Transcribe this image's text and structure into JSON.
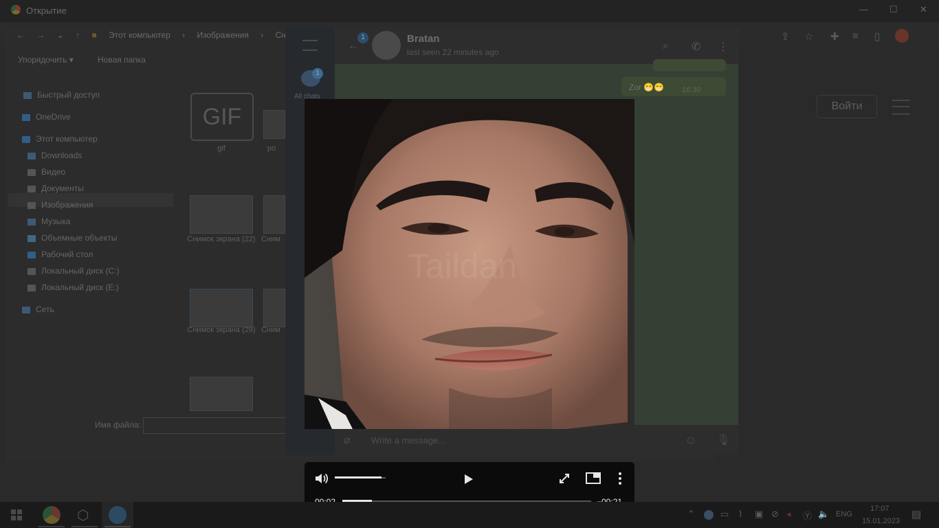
{
  "chrome": {
    "title": "Открытие",
    "login_button": "Войти"
  },
  "explorer": {
    "breadcrumb": [
      "Этот компьютер",
      "Изображения",
      "Снимки э"
    ],
    "toolbar": {
      "organize": "Упорядочить",
      "new_folder": "Новая папка"
    },
    "nav": [
      {
        "label": "Быстрый доступ",
        "icon": "star-icon",
        "color": "#3d5a75"
      },
      {
        "label": "OneDrive",
        "icon": "cloud-icon",
        "color": "#2f5f88"
      },
      {
        "label": "Этот компьютер",
        "icon": "computer-icon",
        "color": "#2f5f88"
      },
      {
        "label": "Downloads",
        "icon": "download-icon",
        "color": "#3d5a75"
      },
      {
        "label": "Видео",
        "icon": "video-folder-icon",
        "color": "#555"
      },
      {
        "label": "Документы",
        "icon": "documents-folder-icon",
        "color": "#555"
      },
      {
        "label": "Изображения",
        "icon": "pictures-folder-icon",
        "color": "#555"
      },
      {
        "label": "Музыка",
        "icon": "music-folder-icon",
        "color": "#3d5a75"
      },
      {
        "label": "Объемные объекты",
        "icon": "3d-objects-icon",
        "color": "#3d6a80"
      },
      {
        "label": "Рабочий стол",
        "icon": "desktop-folder-icon",
        "color": "#2f5f88"
      },
      {
        "label": "Локальный диск (C:)",
        "icon": "drive-icon",
        "color": "#555"
      },
      {
        "label": "Локальный диск (E:)",
        "icon": "drive-icon",
        "color": "#555"
      },
      {
        "label": "Сеть",
        "icon": "network-icon",
        "color": "#3d5a75"
      }
    ],
    "files": {
      "gif_icon_text": "GIF",
      "gif_label": "gif",
      "partial_label": "ро",
      "screenshot1": "Снимок экрана (22)",
      "screenshot1_partial": "Сним",
      "screenshot2": "Снимок экрана (29)",
      "screenshot2_partial": "Сним"
    },
    "filename_label": "Имя файла:"
  },
  "telegram": {
    "contact_name": "Bratan",
    "contact_status": "last seen 22 minutes ago",
    "unread_badge": "1",
    "folders_badge": "1",
    "all_chats_label": "All chats",
    "messages": [
      {
        "text": "Zor 😁😁",
        "time": "16:30"
      }
    ],
    "compose_placeholder": "Write a message..."
  },
  "video_player": {
    "current_time": "00:02",
    "remaining_time": "−00:21",
    "progress": 0.12,
    "volume": 0.92,
    "watermark": "Taildan"
  },
  "taskbar": {
    "language": "ENG",
    "time": "17:07",
    "date": "15.01.2023"
  },
  "colors": {
    "controls_bg": "#0b0b0b",
    "controls_fg": "#e6e6e6"
  }
}
